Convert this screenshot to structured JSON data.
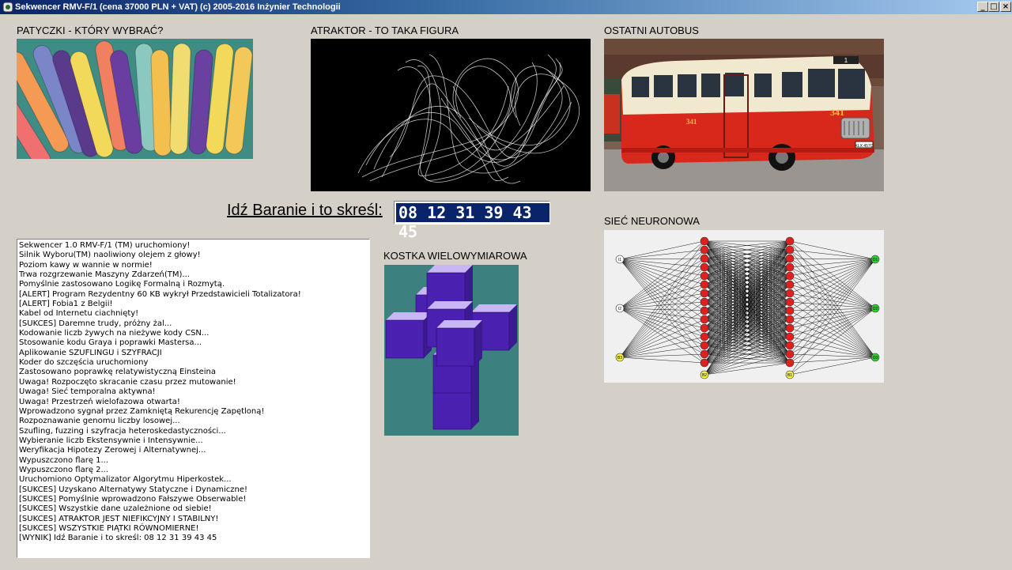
{
  "window": {
    "title": "Sekwencer RMV-F/1 (cena 37000 PLN + VAT) (c) 2005-2016 Inżynier Technologii",
    "minimize": "_",
    "maximize": "□",
    "close": "×"
  },
  "panels": {
    "sticks": "PATYCZKI - KTÓRY WYBRAĆ?",
    "attractor": "ATRAKTOR - TO TAKA FIGURA",
    "bus": "OSTATNI AUTOBUS",
    "network": "SIEĆ NEURONOWA",
    "cube": "KOSTKA WIELOWYMIAROWA"
  },
  "bus": {
    "route": "1",
    "number": "341",
    "number_side": "341",
    "plate": "KLX 457Q"
  },
  "result": {
    "label": "Idź Baranie i to skreśl:",
    "value": "08 12 31 39 43 45"
  },
  "network": {
    "inputs": [
      "I1",
      "I2",
      "B3"
    ],
    "bias_hidden": [
      "B2",
      "B1"
    ],
    "outputs": [
      "O1",
      "O2",
      "O3"
    ]
  },
  "log": [
    "Sekwencer 1.0 RMV-F/1 (TM) uruchomiony!",
    "Silnik Wyboru(TM) naoliwiony olejem z głowy!",
    "Poziom kawy w wannie w normie!",
    "Trwa rozgrzewanie Maszyny Zdarzeń(TM)...",
    "Pomyślnie zastosowano Logikę Formalną i Rozmytą.",
    "[ALERT] Program Rezydentny 60 KB wykrył Przedstawicieli Totalizatora!",
    "[ALERT] Fobia1 z Belgii!",
    "Kabel od Internetu ciachnięty!",
    "[SUKCES] Daremne trudy, próżny żal...",
    "Kodowanie liczb żywych na nieżywe kody CSN...",
    "Stosowanie kodu Graya i poprawki Mastersa...",
    "Aplikowanie SZUFLINGU i SZYFRACJI",
    "Koder do szczęścia uruchomiony",
    "Zastosowano poprawkę relatywistyczną Einsteina",
    "Uwaga! Rozpoczęto skracanie czasu przez mutowanie!",
    "Uwaga! Sieć temporalna aktywna!",
    "Uwaga! Przestrzeń wielofazowa otwarta!",
    "Wprowadzono sygnał przez Zamkniętą Rekurencję Zapętloną!",
    "Rozpoznawanie genomu liczby losowej...",
    "Szufling, fuzzing i szyfracja heteroskedastyczności...",
    "Wybieranie liczb Ekstensywnie i Intensywnie...",
    "Weryfikacja Hipotezy Zerowej i Alternatywnej...",
    "Wypuszczono flarę 1...",
    "Wypuszczono flarę 2...",
    "Uruchomiono Optymalizator Algorytmu Hiperkostek...",
    "[SUKCES] Uzyskano Alternatywy Statyczne i Dynamiczne!",
    "[SUKCES] Pomyślnie wprowadzono Fałszywe Obserwable!",
    "[SUKCES] Wszystkie dane uzależnione od siebie!",
    "[SUKCES] ATRAKTOR JEST NIEFIKCYJNY I STABILNY!",
    "[SUKCES] WSZYSTKIE PIĄTKI RÓWNOMIERNE!",
    "[WYNIK] Idź Baranie i to skreśl: 08 12 31 39 43 45"
  ]
}
